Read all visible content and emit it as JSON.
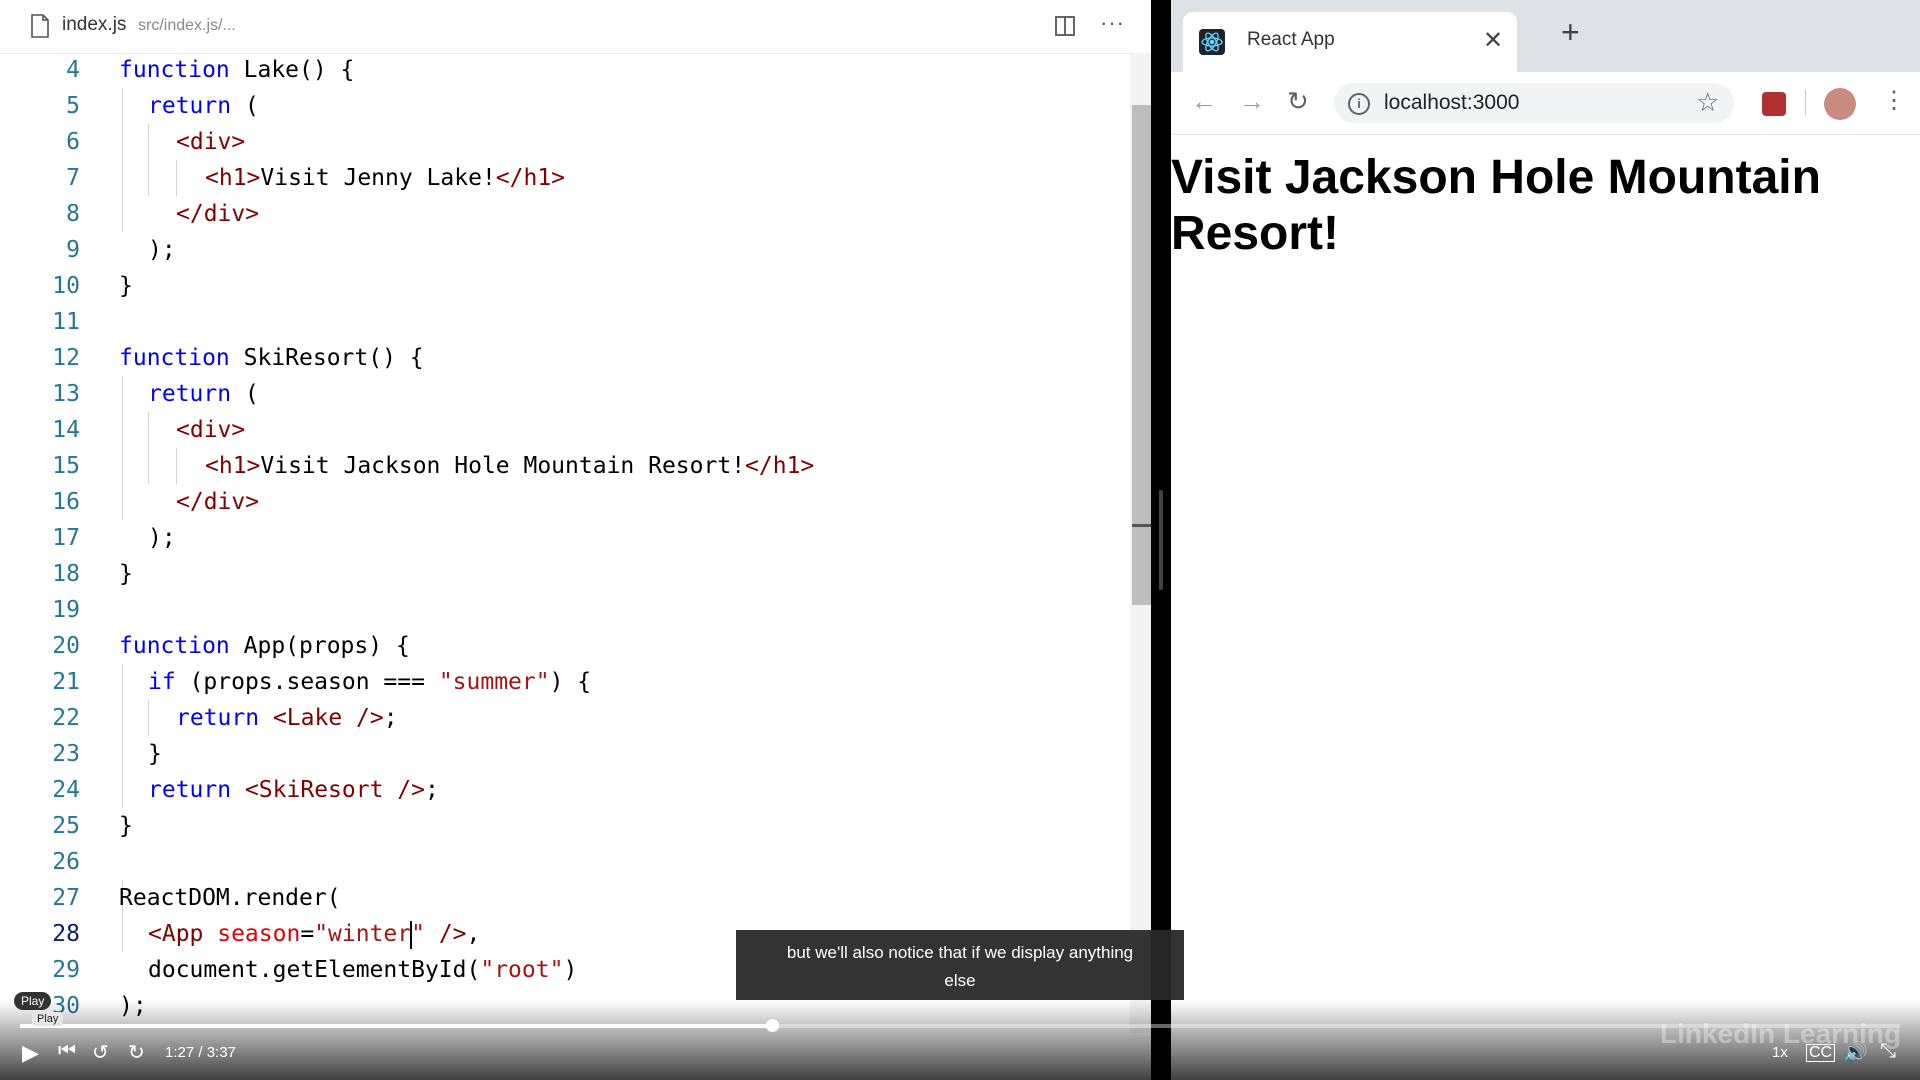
{
  "editor": {
    "file_name": "index.js",
    "file_path": "src/index.js/...",
    "lines": [
      {
        "n": "4"
      },
      {
        "n": "5"
      },
      {
        "n": "6"
      },
      {
        "n": "7"
      },
      {
        "n": "8"
      },
      {
        "n": "9"
      },
      {
        "n": "10"
      },
      {
        "n": "11"
      },
      {
        "n": "12"
      },
      {
        "n": "13"
      },
      {
        "n": "14"
      },
      {
        "n": "15"
      },
      {
        "n": "16"
      },
      {
        "n": "17"
      },
      {
        "n": "18"
      },
      {
        "n": "19"
      },
      {
        "n": "20"
      },
      {
        "n": "21"
      },
      {
        "n": "22"
      },
      {
        "n": "23"
      },
      {
        "n": "24"
      },
      {
        "n": "25"
      },
      {
        "n": "26"
      },
      {
        "n": "27"
      },
      {
        "n": "28"
      },
      {
        "n": "29"
      },
      {
        "n": "30"
      }
    ],
    "code": {
      "l4a": "function",
      "l4b": " Lake() {",
      "l5a": "return",
      "l5b": " (",
      "l6": "<div>",
      "l7a": "<h1>",
      "l7b": "Visit Jenny Lake!",
      "l7c": "</h1>",
      "l8": "</div>",
      "l9": ");",
      "l10": "}",
      "l12a": "function",
      "l12b": " SkiResort() {",
      "l13a": "return",
      "l13b": " (",
      "l14": "<div>",
      "l15a": "<h1>",
      "l15b": "Visit Jackson Hole Mountain Resort!",
      "l15c": "</h1>",
      "l16": "</div>",
      "l17": ");",
      "l18": "}",
      "l20a": "function",
      "l20b": " App(props) {",
      "l21a": "if",
      "l21b": " (props.season === ",
      "l21c": "\"summer\"",
      "l21d": ") {",
      "l22a": "return",
      "l22b": " ",
      "l22c": "<Lake />",
      "l22d": ";",
      "l23": "}",
      "l24a": "return",
      "l24b": " ",
      "l24c": "<SkiResort />",
      "l24d": ";",
      "l25": "}",
      "l27": "ReactDOM.render(",
      "l28a": "<App",
      "l28b": " season",
      "l28c": "=",
      "l28d": "\"winter",
      "l28e": "\"",
      "l28f": " />",
      "l28g": ",",
      "l29a": "document.getElementById(",
      "l29b": "\"root\"",
      "l29c": ")",
      "l30": ");"
    }
  },
  "browser": {
    "tab_title": "React App",
    "url": "localhost:3000",
    "heading": "Visit Jackson Hole Mountain Resort!"
  },
  "caption": {
    "line1": "but we'll also notice that if we display anything",
    "line2": "else"
  },
  "player": {
    "time": "1:27 / 3:37",
    "progress": 0.4,
    "speed": "1x",
    "play_tooltip": "Play",
    "play_tooltip2": "Play",
    "watermark": "LinkedIn Learning"
  }
}
